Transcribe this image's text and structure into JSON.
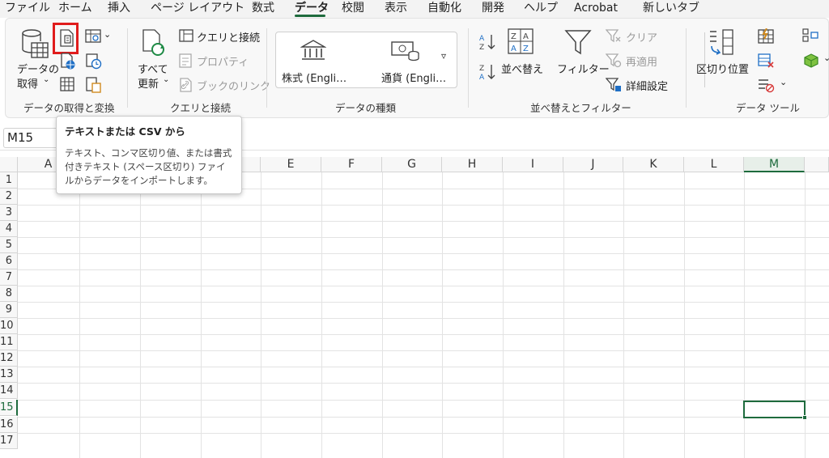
{
  "tabs": [
    "ファイル",
    "ホーム",
    "挿入",
    "ページ レイアウト",
    "数式",
    "データ",
    "校閲",
    "表示",
    "自動化",
    "開発",
    "ヘルプ",
    "Acrobat",
    "新しいタブ"
  ],
  "ribbon": {
    "get_data_label_1": "データの",
    "get_data_label_2": "取得",
    "refresh_label_1": "すべて",
    "refresh_label_2": "更新",
    "queries_connections": "クエリと接続",
    "properties": "プロパティ",
    "book_links": "ブックのリンク",
    "stocks": "株式 (Engli…",
    "currencies": "通貨 (Engli…",
    "sort": "並べ替え",
    "filter": "フィルター",
    "clear": "クリア",
    "reapply": "再適用",
    "advanced": "詳細設定",
    "text_to_columns": "区切り位置",
    "groups": {
      "get_transform": "データの取得と変換",
      "queries": "クエリと接続",
      "data_types": "データの種類",
      "sort_filter": "並べ替えとフィルター",
      "data_tools": "データ ツール"
    }
  },
  "name_box": "M15",
  "tooltip": {
    "title": "テキストまたは CSV から",
    "line1": "テキスト、コンマ区切り値、または書式",
    "line2": "付きテキスト (スペース区切り) ファイ",
    "line3": "ルからデータをインポートします。"
  },
  "columns": [
    "A",
    "B",
    "C",
    "D",
    "E",
    "F",
    "G",
    "H",
    "I",
    "J",
    "K",
    "L",
    "M"
  ],
  "rows": [
    "1",
    "2",
    "3",
    "4",
    "5",
    "6",
    "7",
    "8",
    "9",
    "10",
    "11",
    "12",
    "13",
    "14",
    "15",
    "16",
    "17"
  ],
  "selected_cell": "M15",
  "colors": {
    "accent": "#1e6b3d",
    "highlight": "#e01c1c"
  }
}
